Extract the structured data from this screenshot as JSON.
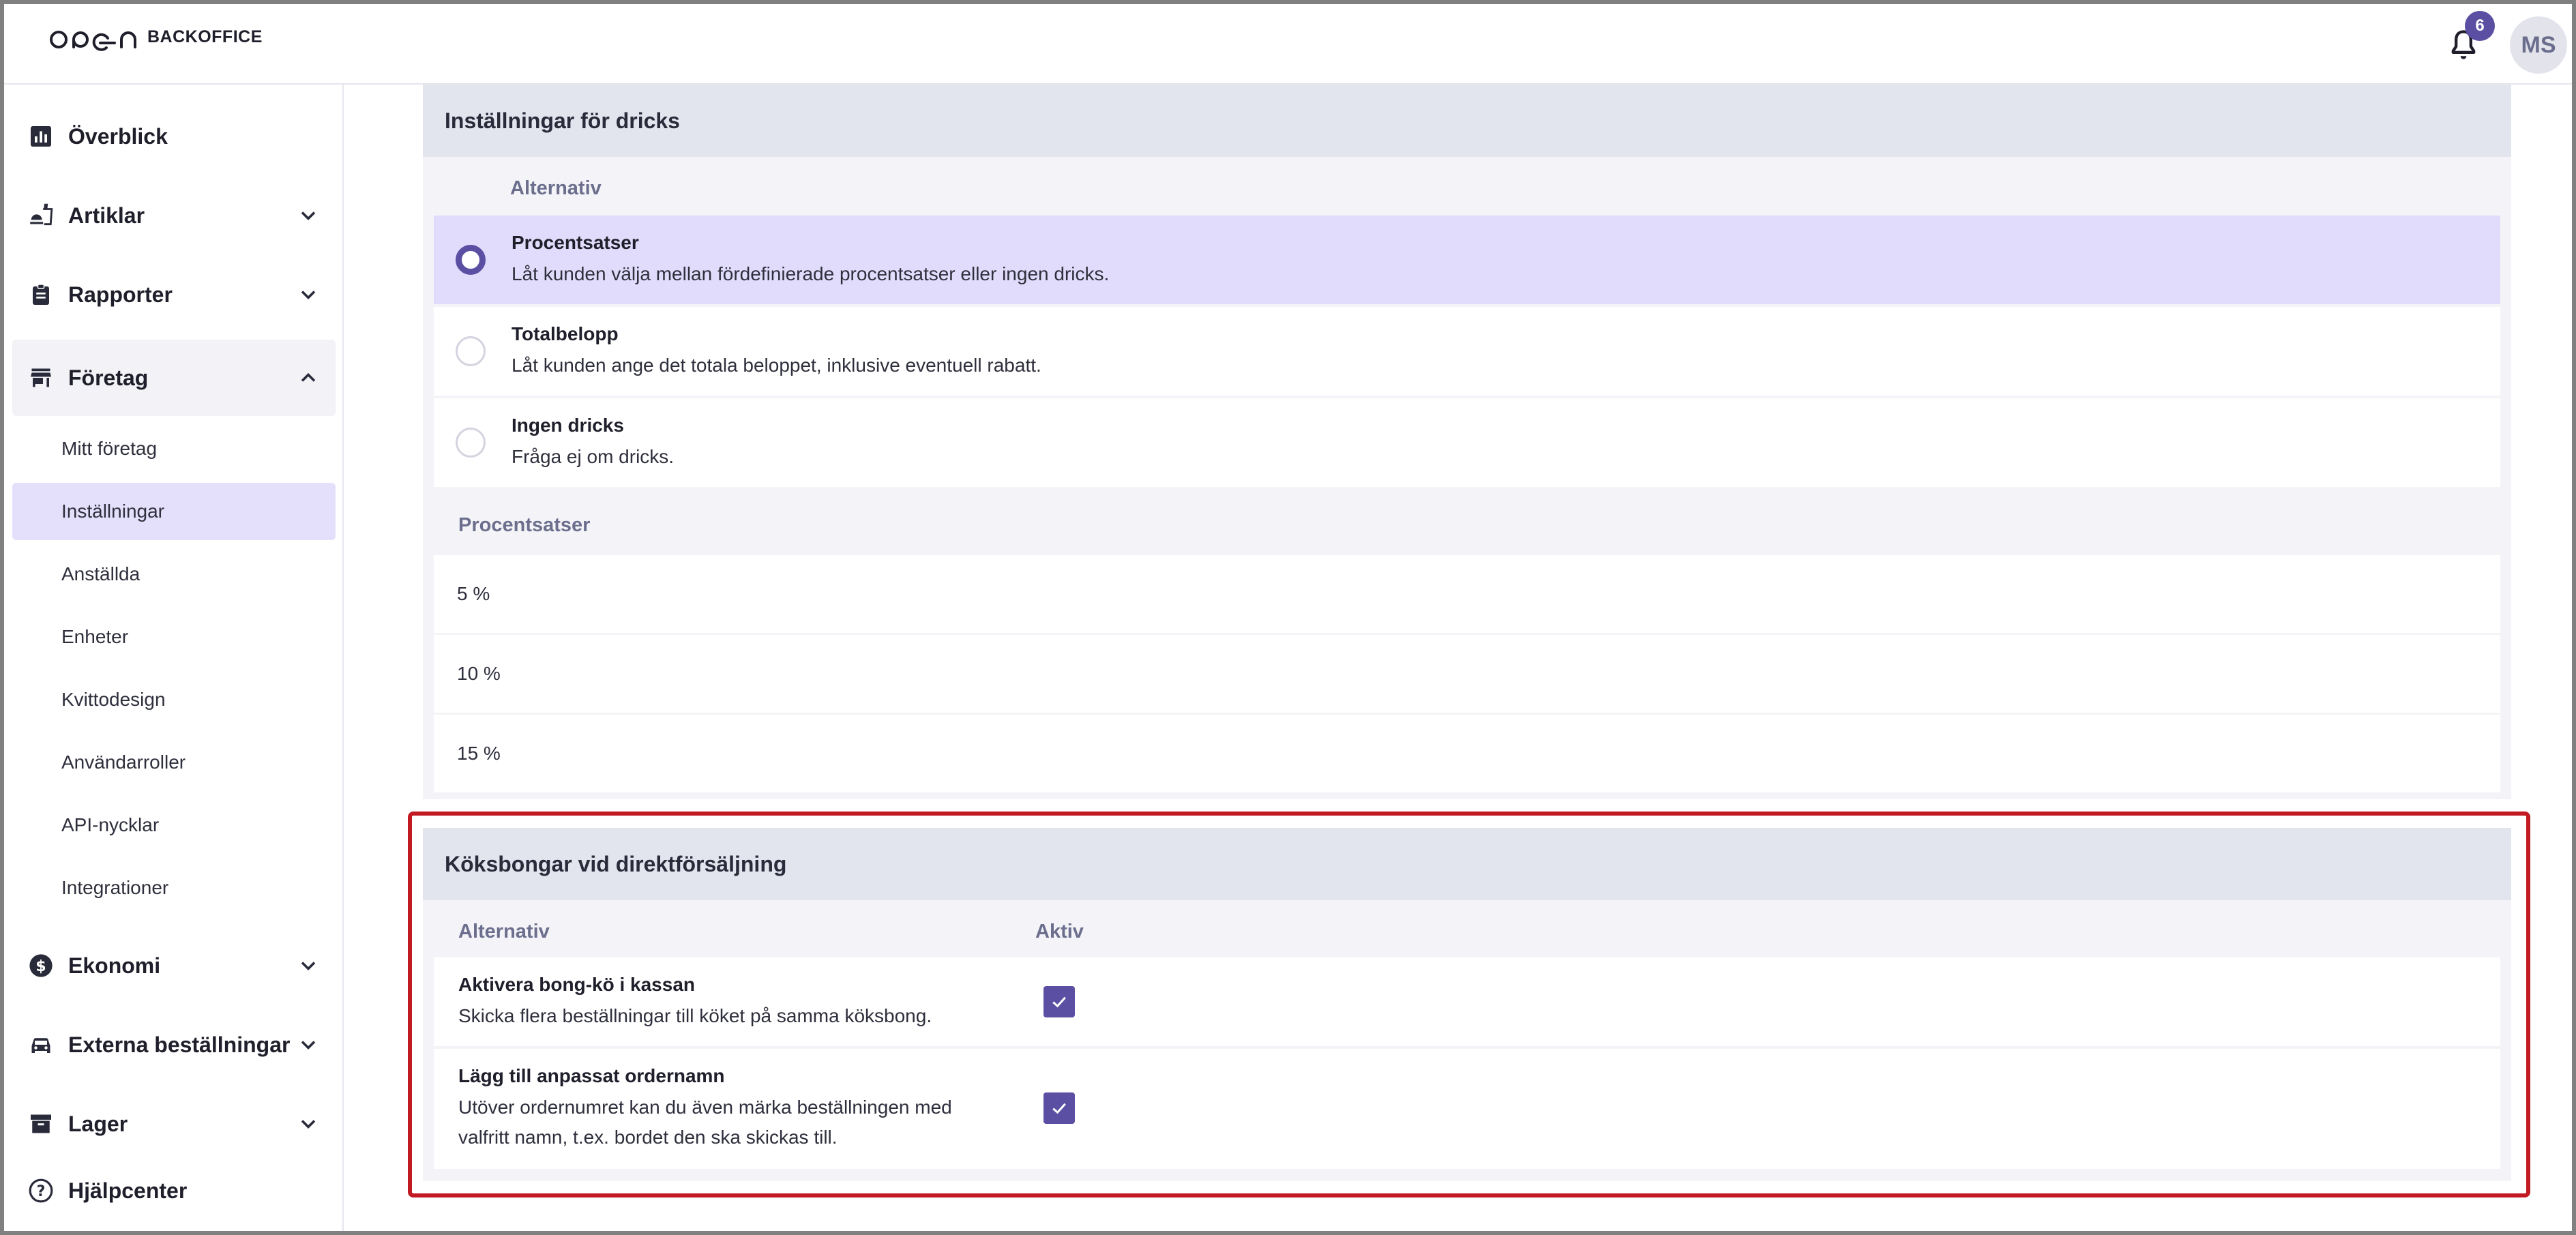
{
  "app": {
    "logo_text": "BACKOFFICE",
    "notifications_count": "6",
    "user_initials": "MS"
  },
  "sidebar": {
    "overview": "Överblick",
    "articles": "Artiklar",
    "reports": "Rapporter",
    "company": "Företag",
    "company_items": [
      "Mitt företag",
      "Inställningar",
      "Anställda",
      "Enheter",
      "Kvittodesign",
      "Användarroller",
      "API-nycklar",
      "Integrationer"
    ],
    "economy": "Ekonomi",
    "external_orders": "Externa beställningar",
    "stock": "Lager",
    "help": "Hjälpcenter"
  },
  "tips": {
    "title": "Inställningar för dricks",
    "column": "Alternativ",
    "options": [
      {
        "title": "Procentsatser",
        "desc": "Låt kunden välja mellan fördefinierade procentsatser eller ingen dricks.",
        "selected": true
      },
      {
        "title": "Totalbelopp",
        "desc": "Låt kunden ange det totala beloppet, inklusive eventuell rabatt.",
        "selected": false
      },
      {
        "title": "Ingen dricks",
        "desc": "Fråga ej om dricks.",
        "selected": false
      }
    ],
    "percent_header": "Procentsatser",
    "percentages": [
      "5 %",
      "10 %",
      "15 %"
    ]
  },
  "kitchen": {
    "title": "Köksbongar vid direktförsäljning",
    "col_option": "Alternativ",
    "col_active": "Aktiv",
    "rows": [
      {
        "title": "Aktivera bong-kö i kassan",
        "desc": "Skicka flera beställningar till köket på samma köksbong.",
        "active": true
      },
      {
        "title": "Lägg till anpassat ordernamn",
        "desc": "Utöver ordernumret kan du även märka beställningen med valfritt namn, t.ex. bordet den ska skickas till.",
        "active": true
      }
    ]
  },
  "colors": {
    "accent": "#5b4fa3",
    "selected_bg": "#e1dcfb",
    "highlight": "#c21a22"
  }
}
